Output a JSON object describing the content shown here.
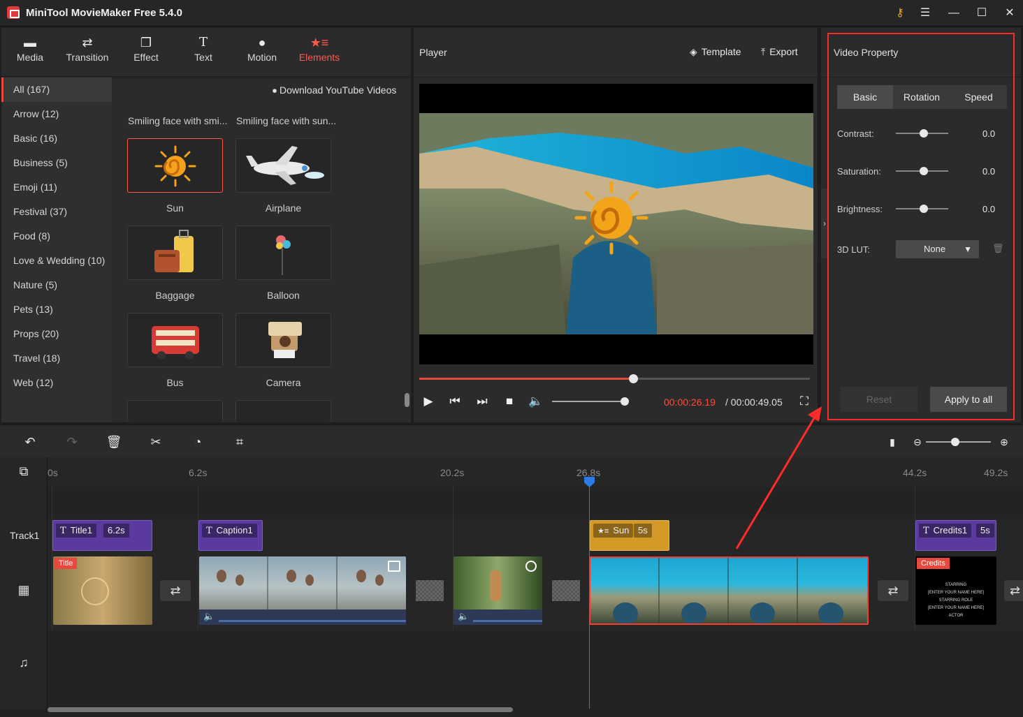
{
  "app": {
    "title": "MiniTool MovieMaker Free 5.4.0",
    "accent": "#e8493e"
  },
  "tabs": [
    {
      "label": "Media",
      "icon": "media-folder-icon"
    },
    {
      "label": "Transition",
      "icon": "transition-arrows-icon"
    },
    {
      "label": "Effect",
      "icon": "effect-layers-icon"
    },
    {
      "label": "Text",
      "icon": "text-T-icon"
    },
    {
      "label": "Motion",
      "icon": "motion-icon"
    },
    {
      "label": "Elements",
      "icon": "elements-icon"
    }
  ],
  "categories": [
    "All (167)",
    "Arrow (12)",
    "Basic (16)",
    "Business (5)",
    "Emoji (11)",
    "Festival (37)",
    "Food (8)",
    "Love & Wedding (10)",
    "Nature (5)",
    "Pets (13)",
    "Props (20)",
    "Travel (18)",
    "Web (12)"
  ],
  "media": {
    "download_label": "Download YouTube Videos",
    "smiley_1": "Smiling face with smi...",
    "smiley_2": "Smiling face with sun...",
    "items": [
      "Sun",
      "Airplane",
      "Baggage",
      "Balloon",
      "Bus",
      "Camera"
    ]
  },
  "player": {
    "label": "Player",
    "template_label": "Template",
    "export_label": "Export",
    "current_time": "00:00:26.19",
    "total_time": "/ 00:00:49.05",
    "progress": 0.547,
    "volume": 1.0
  },
  "property": {
    "title": "Video Property",
    "tabs": [
      "Basic",
      "Rotation",
      "Speed"
    ],
    "rows": [
      {
        "label": "Contrast:",
        "value": "0.0"
      },
      {
        "label": "Saturation:",
        "value": "0.0"
      },
      {
        "label": "Brightness:",
        "value": "0.0"
      }
    ],
    "lut_label": "3D LUT:",
    "lut_value": "None",
    "reset_label": "Reset",
    "apply_label": "Apply to all"
  },
  "timeline": {
    "ticks": [
      "0s",
      "6.2s",
      "20.2s",
      "26.8s",
      "44.2s",
      "49.2s"
    ],
    "track_label": "Track1",
    "text_clips": [
      {
        "name": "Title1",
        "dur": "6.2s"
      },
      {
        "name": "Caption1"
      },
      {
        "name": "Sun",
        "dur": "5s"
      },
      {
        "name": "Credits1",
        "dur": "5s"
      }
    ],
    "title_tag": "Title",
    "credits_tag": "Credits",
    "credits_lines": [
      "STARRING",
      "[ENTER YOUR NAME HERE]",
      "STARRING ROLE",
      "[ENTER YOUR NAME HERE]",
      "ACTOR"
    ]
  }
}
